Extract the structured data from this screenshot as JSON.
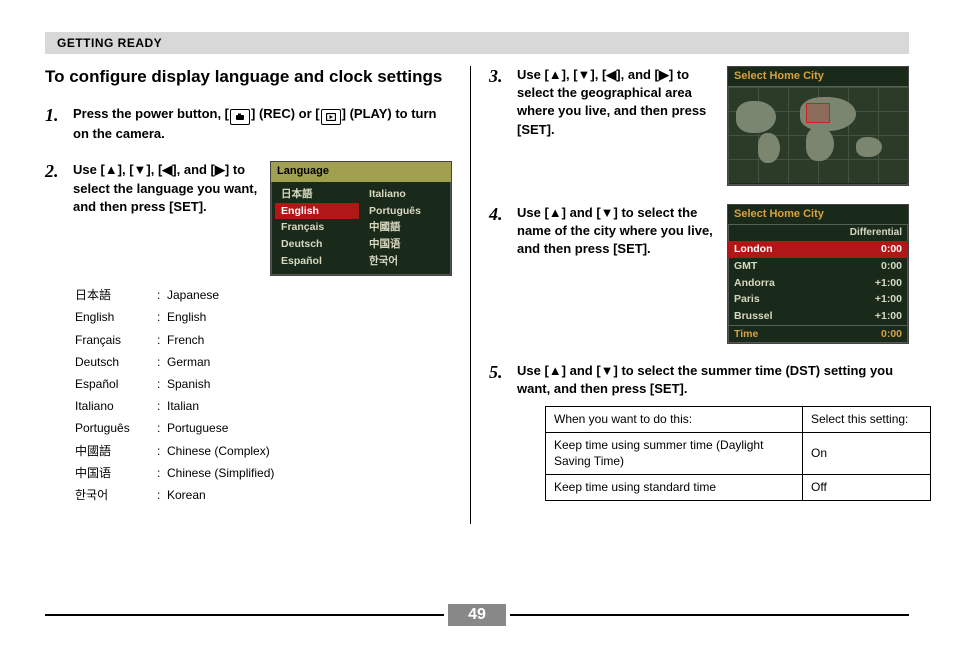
{
  "header": {
    "section": "GETTING READY"
  },
  "title": "To configure display language and clock settings",
  "steps": {
    "s1": {
      "num": "1.",
      "text_a": "Press the power button, [",
      "text_b": "] (REC) or [",
      "text_c": "] (PLAY) to turn on the camera."
    },
    "s2": {
      "num": "2.",
      "text": "Use [▲], [▼], [◀], and [▶] to select the language you want, and then press [SET]."
    },
    "s3": {
      "num": "3.",
      "text": "Use [▲], [▼], [◀], and [▶] to select the geographical area where you live, and then press [SET]."
    },
    "s4": {
      "num": "4.",
      "text": "Use [▲] and [▼] to select the name of the city where you live, and then press [SET]."
    },
    "s5": {
      "num": "5.",
      "text": "Use [▲] and [▼] to select the summer time (DST) setting you want, and then press [SET]."
    }
  },
  "lang_list": [
    {
      "native": "日本語",
      "name": "Japanese"
    },
    {
      "native": "English",
      "name": "English"
    },
    {
      "native": "Français",
      "name": "French"
    },
    {
      "native": "Deutsch",
      "name": "German"
    },
    {
      "native": "Español",
      "name": "Spanish"
    },
    {
      "native": "Italiano",
      "name": "Italian"
    },
    {
      "native": "Português",
      "name": "Portuguese"
    },
    {
      "native": "中國語",
      "name": "Chinese (Complex)"
    },
    {
      "native": "中国语",
      "name": "Chinese (Simplified)"
    },
    {
      "native": "한국어",
      "name": "Korean"
    }
  ],
  "lcd_lang": {
    "title": "Language",
    "left": [
      "日本語",
      "English",
      "Français",
      "Deutsch",
      "Español"
    ],
    "right": [
      "Italiano",
      "Português",
      "中國語",
      "中国语",
      "한국어"
    ],
    "selected": "English"
  },
  "lcd_map": {
    "title": "Select Home City"
  },
  "lcd_city": {
    "title": "Select Home City",
    "sub": "Differential",
    "rows": [
      {
        "city": "London",
        "offset": "0:00",
        "sel": true
      },
      {
        "city": "GMT",
        "offset": "0:00"
      },
      {
        "city": "Andorra",
        "offset": "+1:00"
      },
      {
        "city": "Paris",
        "offset": "+1:00"
      },
      {
        "city": "Brussel",
        "offset": "+1:00"
      }
    ],
    "footer_label": "Time",
    "footer_value": "0:00"
  },
  "dst_table": {
    "h1": "When you want to do this:",
    "h2": "Select this setting:",
    "r1a": "Keep time using summer time (Daylight Saving Time)",
    "r1b": "On",
    "r2a": "Keep time using standard time",
    "r2b": "Off"
  },
  "page_number": "49"
}
